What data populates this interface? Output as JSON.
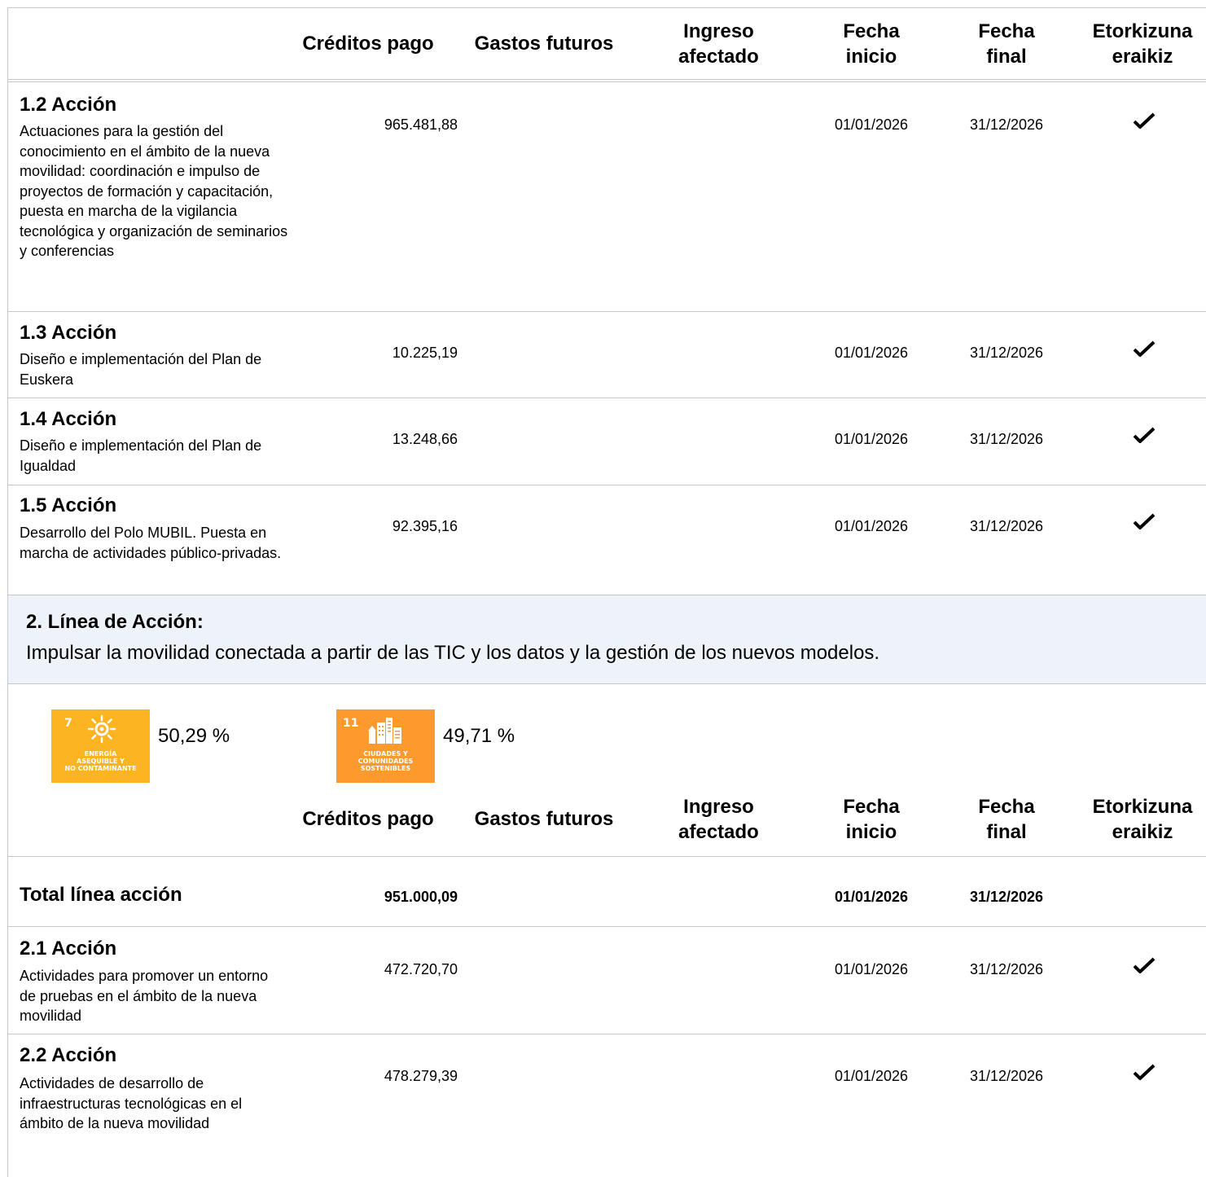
{
  "table_headers": {
    "creditos": "Créditos pago",
    "gastos": "Gastos futuros",
    "ingreso": "Ingreso afectado",
    "fecha_inicio": "Fecha inicio",
    "fecha_final": "Fecha final",
    "etorkizuna": "Etorkizuna eraikiz"
  },
  "actions_line1": [
    {
      "title": "1.2 Acción",
      "description": "Actuaciones para la gestión del conocimiento en el ámbito de la nueva movilidad: coordinación e impulso de proyectos de formación y capacitación, puesta en marcha de la vigilancia tecnológica y organización de seminarios y conferencias",
      "creditos": "965.481,88",
      "fecha_inicio": "01/01/2026",
      "fecha_final": "31/12/2026",
      "etorkizuna": true
    },
    {
      "title": "1.3 Acción",
      "description": "Diseño e implementación del Plan de Euskera",
      "creditos": "10.225,19",
      "fecha_inicio": "01/01/2026",
      "fecha_final": "31/12/2026",
      "etorkizuna": true
    },
    {
      "title": "1.4 Acción",
      "description": "Diseño e implementación del Plan de Igualdad",
      "creditos": "13.248,66",
      "fecha_inicio": "01/01/2026",
      "fecha_final": "31/12/2026",
      "etorkizuna": true
    },
    {
      "title": "1.5 Acción",
      "description": "Desarrollo del Polo MUBIL. Puesta en marcha de actividades público-privadas.",
      "creditos": "92.395,16",
      "fecha_inicio": "01/01/2026",
      "fecha_final": "31/12/2026",
      "etorkizuna": true
    }
  ],
  "line2": {
    "title": "2. Línea de Acción:",
    "description": "Impulsar la movilidad conectada a partir de las TIC y los datos y la gestión de los nuevos modelos."
  },
  "sdg": [
    {
      "number": "7",
      "label_lines": [
        "ENERGÍA",
        "ASEQUIBLE Y",
        "NO CONTAMINANTE"
      ],
      "percent": "50,29 %",
      "color": "#fcb421",
      "icon": "sun-icon"
    },
    {
      "number": "11",
      "label_lines": [
        "CIUDADES Y",
        "COMUNIDADES",
        "SOSTENIBLES"
      ],
      "percent": "49,71 %",
      "color": "#fd9a2e",
      "icon": "city-buildings-icon"
    }
  ],
  "total_line": {
    "label": "Total línea acción",
    "creditos": "951.000,09",
    "fecha_inicio": "01/01/2026",
    "fecha_final": "31/12/2026"
  },
  "actions_line2": [
    {
      "title": "2.1 Acción",
      "description": "Actividades para promover un entorno de pruebas en el ámbito de la nueva movilidad",
      "creditos": "472.720,70",
      "fecha_inicio": "01/01/2026",
      "fecha_final": "31/12/2026",
      "etorkizuna": true
    },
    {
      "title": "2.2 Acción",
      "description": "Actividades de desarrollo de infraestructuras tecnológicas en el ámbito de la nueva movilidad",
      "creditos": "478.279,39",
      "fecha_inicio": "01/01/2026",
      "fecha_final": "31/12/2026",
      "etorkizuna": true
    }
  ]
}
